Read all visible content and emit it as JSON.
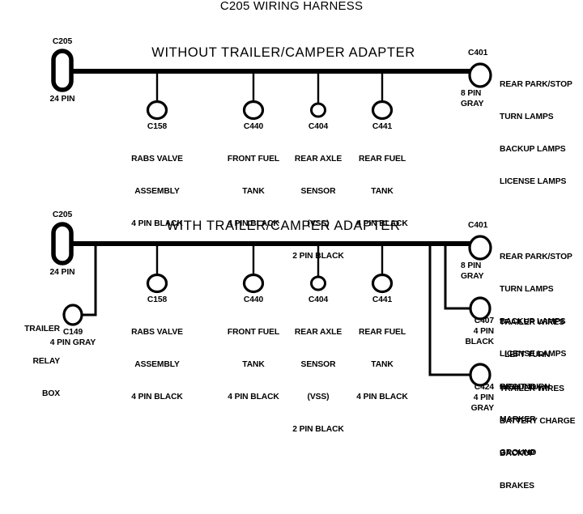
{
  "document": {
    "title": "C205 WIRING HARNESS"
  },
  "colors": {
    "background": "#ffffff",
    "wire": "#000000",
    "text": "#000000"
  },
  "sections": [
    {
      "id": "without-adapter",
      "heading": "WITHOUT TRAILER/CAMPER ADAPTER",
      "source_connector": {
        "id": "C205",
        "pins": "24 PIN",
        "shape": "pill"
      },
      "end_connector": {
        "id": "C401",
        "pins": "8 PIN",
        "color": "GRAY",
        "functions": [
          "REAR PARK/STOP",
          "TURN LAMPS",
          "BACKUP LAMPS",
          "LICENSE LAMPS"
        ]
      },
      "branches": [
        {
          "id": "C158",
          "lines": [
            "RABS VALVE",
            "ASSEMBLY",
            "4 PIN BLACK"
          ]
        },
        {
          "id": "C440",
          "lines": [
            "FRONT FUEL",
            "TANK",
            "4 PIN BLACK"
          ]
        },
        {
          "id": "C404",
          "lines": [
            "REAR AXLE",
            "SENSOR",
            "(VSS)",
            "2 PIN BLACK"
          ]
        },
        {
          "id": "C441",
          "lines": [
            "REAR FUEL",
            "TANK",
            "4 PIN BLACK"
          ]
        }
      ]
    },
    {
      "id": "with-adapter",
      "heading": "WITH TRAILER/CAMPER ADAPTER",
      "source_connector": {
        "id": "C205",
        "pins": "24 PIN",
        "shape": "pill"
      },
      "trailer_relay": {
        "label_lines": [
          "TRAILER",
          "RELAY",
          "BOX"
        ],
        "id": "C149",
        "pins_color": "4 PIN GRAY"
      },
      "end_connector": {
        "id": "C401",
        "pins": "8 PIN",
        "color": "GRAY",
        "functions": [
          "REAR PARK/STOP",
          "TURN LAMPS",
          "BACKUP LAMPS",
          "LICENSE LAMPS",
          "GROUND"
        ]
      },
      "branches": [
        {
          "id": "C158",
          "lines": [
            "RABS VALVE",
            "ASSEMBLY",
            "4 PIN BLACK"
          ]
        },
        {
          "id": "C440",
          "lines": [
            "FRONT FUEL",
            "TANK",
            "4 PIN BLACK"
          ]
        },
        {
          "id": "C404",
          "lines": [
            "REAR AXLE",
            "SENSOR",
            "(VSS)",
            "2 PIN BLACK"
          ]
        },
        {
          "id": "C441",
          "lines": [
            "REAR FUEL",
            "TANK",
            "4 PIN BLACK"
          ]
        }
      ],
      "trailer_connectors": [
        {
          "id": "C407",
          "pins": "4 PIN",
          "color": "BLACK",
          "functions": [
            "TRAILER WIRES",
            "LEFT TURN",
            "RIGHT TURN",
            "MARKER",
            "GROUND"
          ]
        },
        {
          "id": "C424",
          "pins": "4 PIN",
          "color": "GRAY",
          "functions": [
            "TRAILER WIRES",
            "BATTERY CHARGE",
            "BACKUP",
            "BRAKES"
          ]
        }
      ]
    }
  ]
}
